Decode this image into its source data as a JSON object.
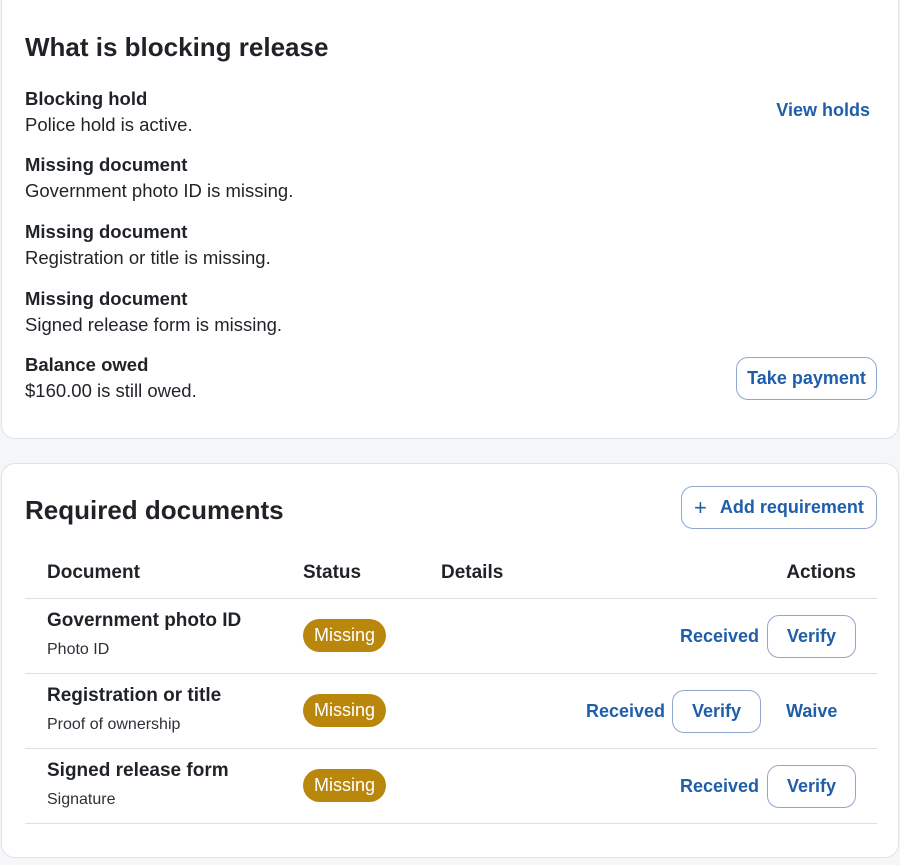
{
  "blocking": {
    "title": "What is blocking release",
    "items": [
      {
        "title": "Blocking hold",
        "text": "Police hold is active."
      },
      {
        "title": "Missing document",
        "text": "Government photo ID is missing."
      },
      {
        "title": "Missing document",
        "text": "Registration or title is missing."
      },
      {
        "title": "Missing document",
        "text": "Signed release form is missing."
      },
      {
        "title": "Balance owed",
        "text": "$160.00 is still owed."
      }
    ],
    "view_holds_label": "View holds",
    "take_payment_label": "Take payment"
  },
  "documents": {
    "title": "Required documents",
    "add_requirement_label": "Add requirement",
    "add_icon": "+",
    "columns": {
      "document": "Document",
      "status": "Status",
      "details": "Details",
      "actions": "Actions"
    },
    "rows": [
      {
        "name": "Government photo ID",
        "type": "Photo ID",
        "status": "Missing",
        "received_label": "Received",
        "verify_label": "Verify"
      },
      {
        "name": "Registration or title",
        "type": "Proof of ownership",
        "status": "Missing",
        "received_label": "Received",
        "verify_label": "Verify",
        "waive_label": "Waive"
      },
      {
        "name": "Signed release form",
        "type": "Signature",
        "status": "Missing",
        "received_label": "Received",
        "verify_label": "Verify"
      }
    ]
  },
  "colors": {
    "link": "#1f5ea8",
    "badge_missing": "#b8870b",
    "card_border": "#dfe2e7",
    "page_bg": "#f5f6f8"
  }
}
